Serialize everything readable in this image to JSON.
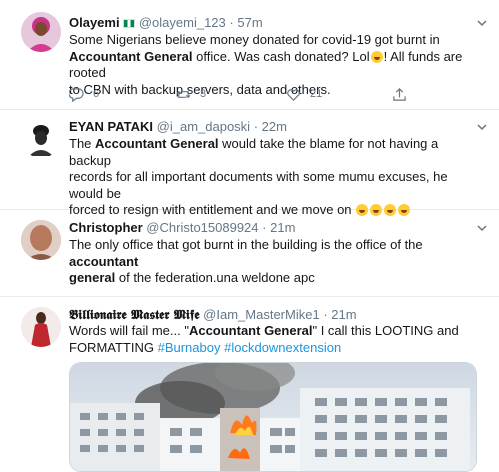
{
  "tweets": [
    {
      "name": "Olayemi",
      "handle": "@olayemi_123",
      "dot": "·",
      "time": "57m",
      "lines": [
        "Some Nigerians believe money donated for covid-19 got burnt in",
        [
          "Accountant General",
          " office. Was cash donated? Lol",
          "! All funds are rooted"
        ],
        "to CBN with backup servers, data and others."
      ],
      "reply_count": "6",
      "retweet_count": "3",
      "like_count": "21"
    },
    {
      "name": "EYAN PATAKI",
      "handle": "@i_am_daposki",
      "dot": "·",
      "time": "22m",
      "lines": [
        [
          "The ",
          "Accountant General",
          " would take the blame for not having a backup"
        ],
        "records for all important documents with some mumu excuses, he would be",
        "forced to resign with entitlement and we move on"
      ]
    },
    {
      "name": "Christopher",
      "handle": "@Christo15089924",
      "dot": "·",
      "time": "21m",
      "lines": [
        [
          "The only office that got burnt in the building is the office of the ",
          "accountant"
        ],
        [
          "general",
          " of the federation.una weldone apc"
        ]
      ]
    },
    {
      "name": "𝕭𝖎𝖑𝖑𝖎𝖔𝖓𝖆𝖎𝖗𝖊 𝕸𝖆𝖘𝖙𝖊𝖗 𝕸𝖎𝖋𝖊",
      "handle": "@Iam_MasterMike1",
      "dot": "·",
      "time": "21m",
      "lines": [
        [
          "Words will fail me... \"",
          "Accountant General",
          "\" I call this LOOTING and"
        ],
        [
          "FORMATTING ",
          "#Burnaboy",
          " ",
          "#lockdownextension"
        ]
      ]
    }
  ],
  "icons": {
    "reply": "reply-icon",
    "retweet": "retweet-icon",
    "like": "like-icon",
    "share": "share-icon",
    "chevron": "chevron-down-icon"
  },
  "colors": {
    "link": "#1b95e0",
    "muted": "#657786",
    "divider": "#e6ecf0"
  }
}
